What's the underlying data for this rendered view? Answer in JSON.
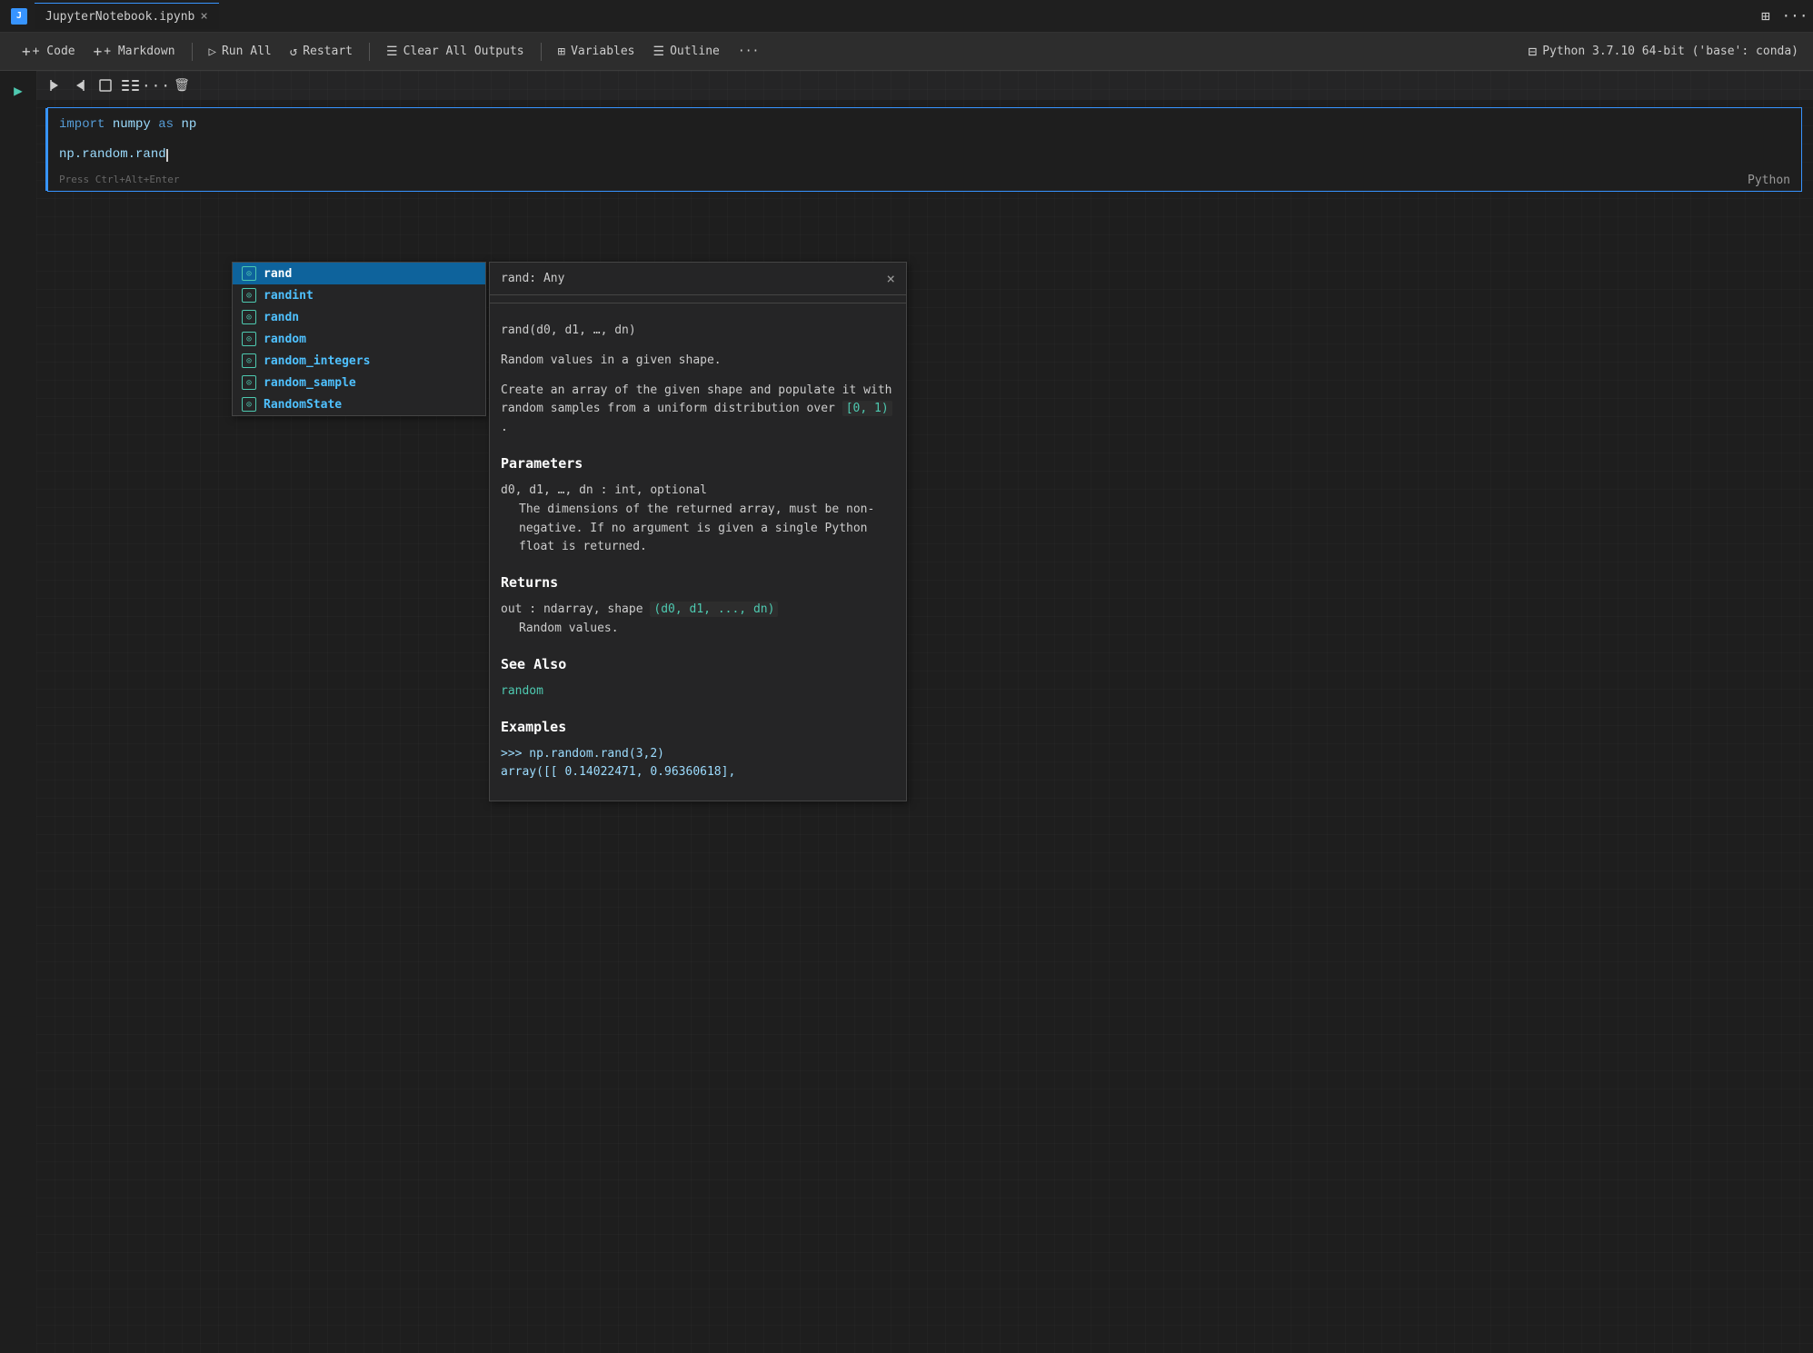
{
  "titlebar": {
    "icon_label": "J",
    "tab_name": "JupyterNotebook.ipynb",
    "close_label": "×",
    "layout_icon": "⊞",
    "more_icon": "···"
  },
  "toolbar": {
    "code_label": "+ Code",
    "markdown_label": "+ Markdown",
    "run_all_label": "Run All",
    "restart_label": "Restart",
    "clear_outputs_label": "Clear All Outputs",
    "variables_label": "Variables",
    "outline_label": "Outline",
    "more_label": "···",
    "kernel_label": "Python 3.7.10 64-bit ('base': conda)"
  },
  "cell_toolbar": {
    "run_above_label": "▷|",
    "run_below_label": "|▷",
    "add_cell_label": "☐",
    "move_label": "⁞⊞",
    "more_label": "···",
    "delete_label": "🗑"
  },
  "cell": {
    "line1_keyword": "import",
    "line1_module": "numpy",
    "line1_as": "as",
    "line1_alias": "np",
    "line2_code": "np.random.rand",
    "hint": "Press Ctrl+Alt+Enter"
  },
  "autocomplete": {
    "items": [
      {
        "icon": "⊙",
        "text": "rand",
        "selected": true
      },
      {
        "icon": "⊙",
        "text": "randint"
      },
      {
        "icon": "⊙",
        "text": "randn"
      },
      {
        "icon": "⊙",
        "text": "random"
      },
      {
        "icon": "⊙",
        "text": "random_integers"
      },
      {
        "icon": "⊙",
        "text": "random_sample"
      },
      {
        "icon": "⊙",
        "text": "RandomState"
      }
    ]
  },
  "doc_panel": {
    "title": "rand: Any",
    "close_label": "×",
    "signature": "rand(d0, d1, …, dn)",
    "description": "Random values in a given shape.",
    "description2": "Create an array of the given shape and populate it with random samples from a uniform distribution over",
    "range_code": "[0, 1)",
    "range_suffix": ".",
    "parameters_title": "Parameters",
    "param_name": "d0, d1, …, dn : int, optional",
    "param_desc": "The dimensions of the returned array, must be non-negative. If no argument is given a single Python float is returned.",
    "returns_title": "Returns",
    "return_name": "out : ndarray, shape",
    "return_code": "(d0, d1, ..., dn)",
    "return_desc": "Random values.",
    "see_also_title": "See Also",
    "see_also_link": "random",
    "examples_title": "Examples",
    "example_code1": ">>> np.random.rand(3,2)",
    "example_code2": "array([[ 0.14022471,   0.96360618],",
    "python_label": "Python"
  },
  "colors": {
    "accent": "#3794ff",
    "selected_bg": "#0e639c",
    "keyword": "#569cd6",
    "identifier": "#9cdcfe",
    "completion": "#4fc1ff",
    "teal": "#4ec9b0"
  }
}
